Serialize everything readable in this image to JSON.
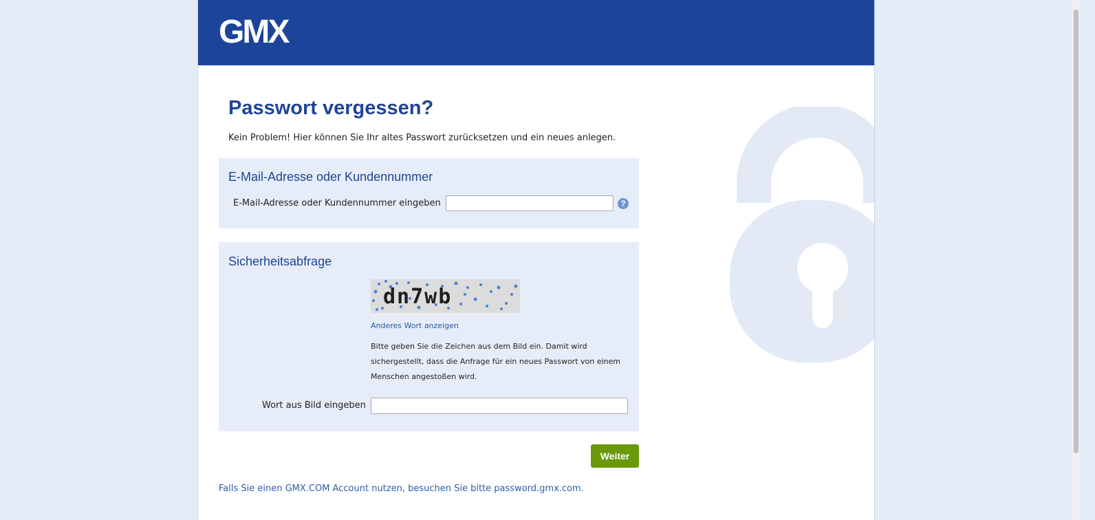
{
  "header": {
    "logo_text": "GMX",
    "background_color": "#1c449b"
  },
  "main": {
    "title": "Passwort vergessen?",
    "intro": "Kein Problem! Hier können Sie Ihr altes Passwort zurücksetzen und ein neues anlegen."
  },
  "email_section": {
    "heading": "E-Mail-Adresse oder Kundennummer",
    "field_label": "E-Mail-Adresse oder Kundennummer eingeben",
    "field_value": "",
    "help_icon": "help-icon"
  },
  "captcha_section": {
    "heading": "Sicherheitsabfrage",
    "captcha_text": "dn7wb",
    "refresh_link": "Anderes Wort anzeigen",
    "hint": "Bitte geben Sie die Zeichen aus dem Bild ein. Damit wird sichergestellt, dass die Anfrage für ein neues Passwort von einem Menschen angestoßen wird.",
    "field_label": "Wort aus Bild eingeben",
    "field_value": ""
  },
  "actions": {
    "submit_label": "Weiter",
    "submit_color": "#6a9a0c"
  },
  "footer": {
    "note": "Falls Sie einen GMX.COM Account nutzen, besuchen Sie bitte password.gmx.com."
  },
  "colors": {
    "accent": "#1f4494",
    "page_background": "#e4ecf8",
    "panel_background": "#e6edf8"
  },
  "decoration": {
    "background_icon": "lock-icon"
  }
}
